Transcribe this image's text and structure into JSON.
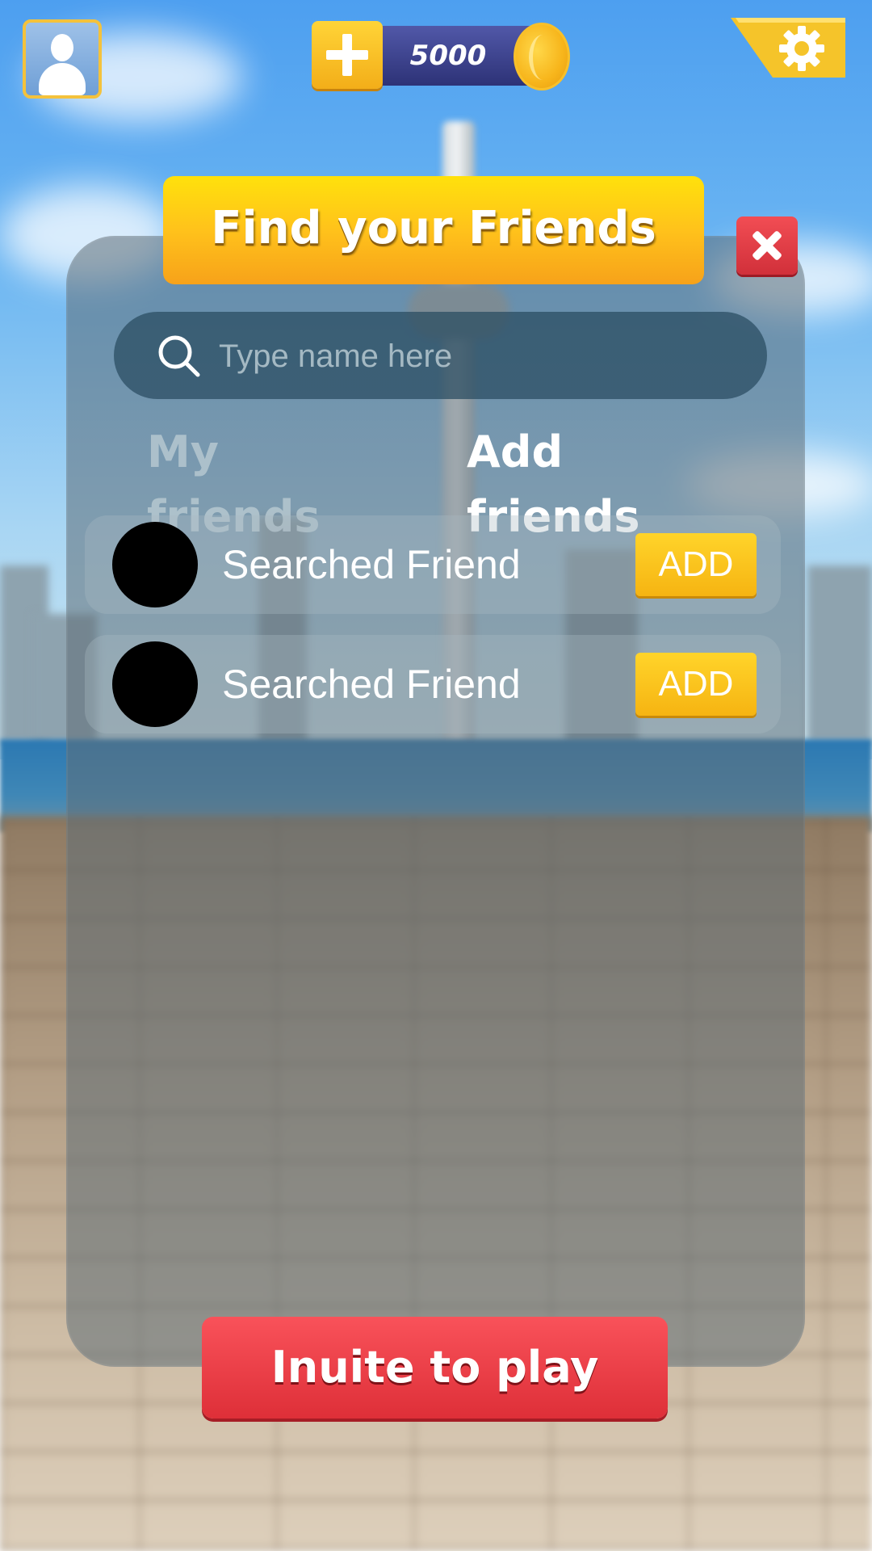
{
  "hud": {
    "coins": "5000"
  },
  "dialog": {
    "title": "Find your Friends",
    "search": {
      "placeholder": "Type name here",
      "value": ""
    },
    "tabs": [
      {
        "label": "My friends",
        "active": false
      },
      {
        "label": "Add friends",
        "active": true
      }
    ],
    "results": [
      {
        "name": "Searched Friend",
        "action": "ADD"
      },
      {
        "name": "Searched Friend",
        "action": "ADD"
      }
    ],
    "invite_label": "Inuite to play"
  },
  "colors": {
    "title_banner": "#ffc21b",
    "add_button": "#f6b412",
    "invite_button": "#de2f38",
    "close_button": "#d1303a",
    "currency_bar": "#2d3277"
  },
  "icons": [
    "avatar-icon",
    "plus-icon",
    "coin-icon",
    "gear-icon",
    "close-icon",
    "search-icon"
  ]
}
